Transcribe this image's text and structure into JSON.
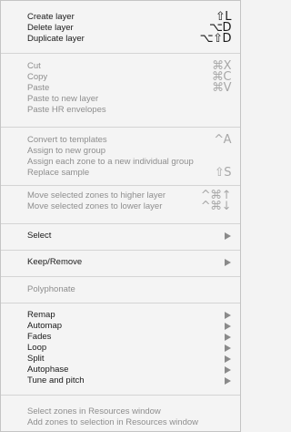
{
  "menu": {
    "layers": {
      "create": {
        "label": "Create layer",
        "shortcut": "⇧L"
      },
      "delete": {
        "label": "Delete layer",
        "shortcut": "⌥D"
      },
      "duplicate": {
        "label": "Duplicate layer",
        "shortcut": "⌥⇧D"
      }
    },
    "clipboard": {
      "cut": {
        "label": "Cut",
        "shortcut": "⌘X"
      },
      "copy": {
        "label": "Copy",
        "shortcut": "⌘C"
      },
      "paste": {
        "label": "Paste",
        "shortcut": "⌘V"
      },
      "paste_new_layer": {
        "label": "Paste to new layer"
      },
      "paste_hr": {
        "label": "Paste HR envelopes"
      }
    },
    "convert": {
      "templates": {
        "label": "Convert to templates",
        "shortcut": "^A"
      },
      "new_group": {
        "label": "Assign to new group"
      },
      "individual_group": {
        "label": "Assign each zone to a new individual group"
      },
      "replace_sample": {
        "label": "Replace sample",
        "shortcut": "⇧S"
      }
    },
    "move": {
      "higher": {
        "label": "Move selected zones to higher layer",
        "shortcut": "^⌘↑"
      },
      "lower": {
        "label": "Move selected zones to lower layer",
        "shortcut": "^⌘↓"
      }
    },
    "select": {
      "label": "Select"
    },
    "keep_remove": {
      "label": "Keep/Remove"
    },
    "polyphonate": {
      "label": "Polyphonate"
    },
    "tools": {
      "remap": {
        "label": "Remap"
      },
      "automap": {
        "label": "Automap"
      },
      "fades": {
        "label": "Fades"
      },
      "loop": {
        "label": "Loop"
      },
      "split": {
        "label": "Split"
      },
      "autophase": {
        "label": "Autophase"
      },
      "tune_pitch": {
        "label": "Tune and pitch"
      }
    },
    "resources": {
      "select_zones": {
        "label": "Select zones in Resources window"
      },
      "add_zones": {
        "label": "Add zones to selection in Resources window"
      }
    },
    "colors": {
      "background": "#f4f4f4",
      "enabled_text": "#1a1a1a",
      "disabled_text": "#8e8e8e",
      "separator": "#d4d4d4",
      "submenu_arrow": "#8a8a8a"
    }
  }
}
